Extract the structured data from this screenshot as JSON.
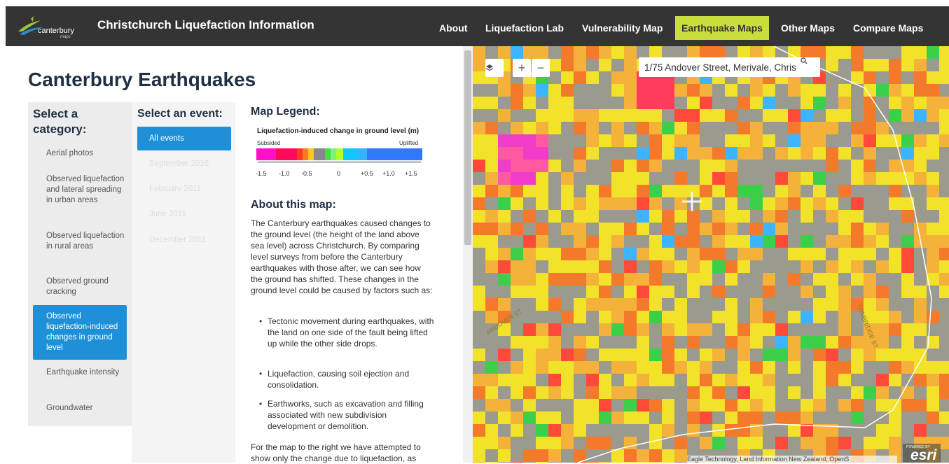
{
  "header": {
    "logo_brand": "canterbury",
    "logo_sub": "maps",
    "title": "Christchurch Liquefaction Information",
    "nav": [
      "About",
      "Liquefaction Lab",
      "Vulnerability Map",
      "Earthquake Maps",
      "Other Maps",
      "Compare Maps"
    ],
    "active_nav": "Earthquake Maps",
    "accent_color": "#c9de3a"
  },
  "page_title": "Canterbury Earthquakes",
  "categories": {
    "heading": "Select a category:",
    "items": [
      "Aerial photos",
      "Observed liquefaction and lateral spreading in urban areas",
      "Observed liquefaction in rural areas",
      "Observed ground cracking",
      "Observed liquefaction-induced changes in ground level",
      "Earthquake intensity",
      "Groundwater"
    ],
    "active": "Observed liquefaction-induced changes in ground level"
  },
  "events": {
    "heading": "Select an event:",
    "items": [
      "All events",
      "September 2010",
      "February 2011",
      "June 2011",
      "December 2011"
    ],
    "active": "All events"
  },
  "legend": {
    "heading": "Map Legend:",
    "title": "Liquefaction-induced change in ground level (m)",
    "left_label": "Subsided",
    "right_label": "Uplifted",
    "ticks": [
      "-1.5",
      "-1.0",
      "-0.5",
      "0",
      "+0.5",
      "+1.0",
      "+1.5"
    ],
    "colors": [
      "#ff10c8",
      "#ff10c8",
      "#ff0a5a",
      "#ff0a5a",
      "#ff3a1e",
      "#ff7a1e",
      "#ffc81e",
      "#888888",
      "#40e040",
      "#7ef07e",
      "#b4ff32",
      "#10c8ff",
      "#32b4ff",
      "#3278ff"
    ]
  },
  "about": {
    "heading": "About this map:",
    "p1": "The Canterbury earthquakes caused changes to the ground level (the height of the land above sea level) across Christchurch. By comparing level surveys from before the Canterbury earthquakes with those after, we can see how the ground has shifted. These changes in the ground level could be caused by factors such as:",
    "bullets": [
      "Tectonic movement during earthquakes, with the land on one side of the fault being lifted up while the other side drops.",
      "Liquefaction, causing soil ejection and consolidation.",
      "Earthworks, such as excavation and filling associated with new subdivision development or demolition."
    ],
    "p2": "For the map to the right we have attempted to show only the change due to liquefaction, as"
  },
  "map": {
    "search_value": "1/75 Andover Street, Merivale, Chris",
    "search_icon": "search-icon",
    "layers_icon": "layers-icon",
    "zoom_in": "+",
    "zoom_out": "−",
    "street_labels": [
      "ANDOVER ST",
      "TONBRIDGE ST"
    ],
    "attribution": "Eagle Technology, Land Information New Zealand, OpenS",
    "powered_by": "POWERED BY",
    "esri": "esri"
  }
}
